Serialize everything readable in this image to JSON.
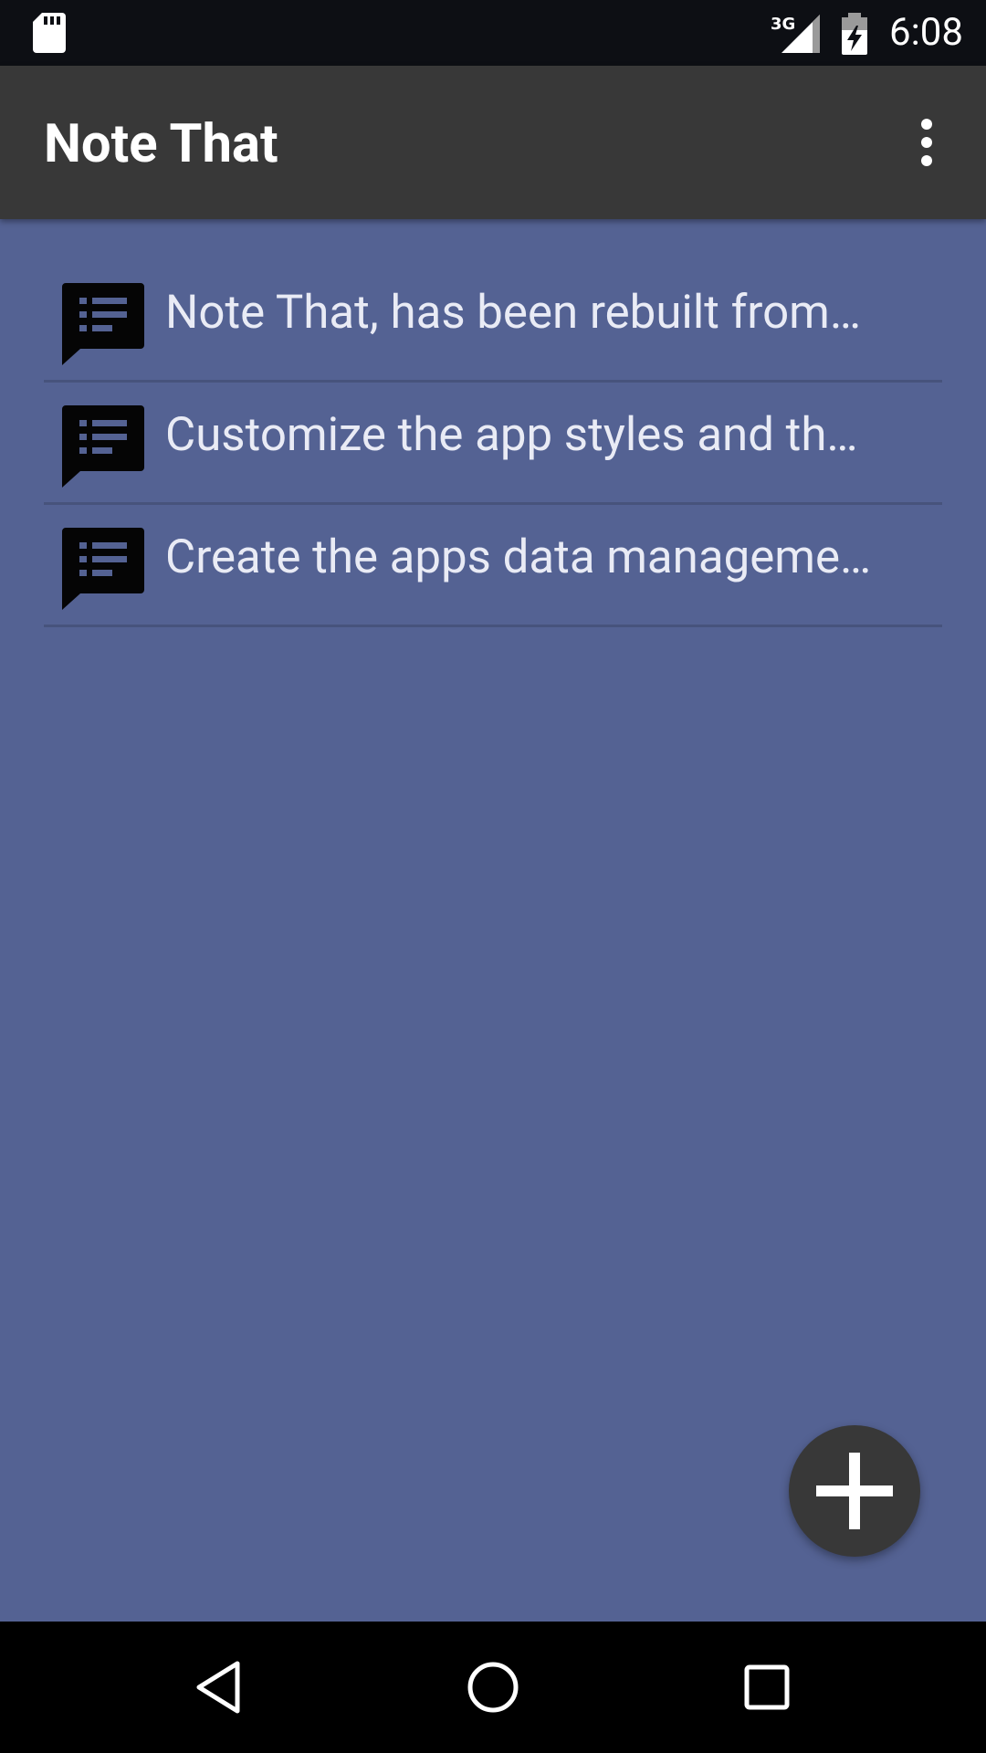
{
  "status_bar": {
    "time": "6:08",
    "network": "3G",
    "icons": [
      "sd-card-icon",
      "cellular-signal-icon",
      "battery-charging-icon"
    ]
  },
  "app_bar": {
    "title": "Note That",
    "menu_icon": "more-vert-icon"
  },
  "notes": [
    {
      "text": "Note That, has been rebuilt from…",
      "icon": "note-list-icon"
    },
    {
      "text": "Customize the app styles and th…",
      "icon": "note-list-icon"
    },
    {
      "text": "Create the apps data manageme…",
      "icon": "note-list-icon"
    }
  ],
  "fab": {
    "icon": "add-icon"
  },
  "nav_bar": {
    "icons": [
      "back-icon",
      "home-icon",
      "recents-icon"
    ]
  },
  "colors": {
    "background": "#546293",
    "app_bar": "#383838",
    "status_bar": "#0d0f14",
    "note_text": "#e9ebf5",
    "divider": "#47537c",
    "icon_accent": "#546293"
  }
}
